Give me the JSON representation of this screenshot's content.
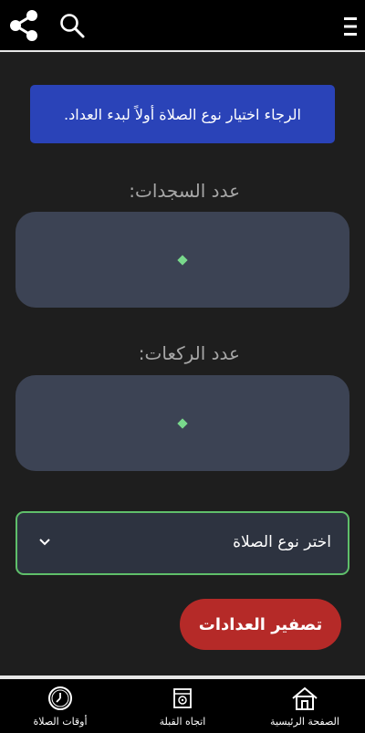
{
  "header": {
    "icons": [
      "share-icon",
      "search-icon",
      "menu-icon"
    ]
  },
  "banner": {
    "text": "الرجاء اختيار نوع الصلاة أولاً لبدء العداد."
  },
  "counters": {
    "sajdat_label": "عدد السجدات:",
    "rakat_label": "عدد الركعات:"
  },
  "prayer_select": {
    "selected": "اختر نوع الصلاة"
  },
  "reset_button": {
    "label": "تصفير العدادات"
  },
  "bottom_nav": {
    "home": "الصفحة الرئيسية",
    "qibla": "اتجاه القبلة",
    "times": "أوقات الصلاة"
  },
  "colors": {
    "banner": "#2a43b8",
    "counter_bg": "#3c4354",
    "dot": "#79d98c",
    "select_border": "#5fbf6a",
    "reset_button": "#b52a28",
    "background": "#1e1e1e"
  }
}
